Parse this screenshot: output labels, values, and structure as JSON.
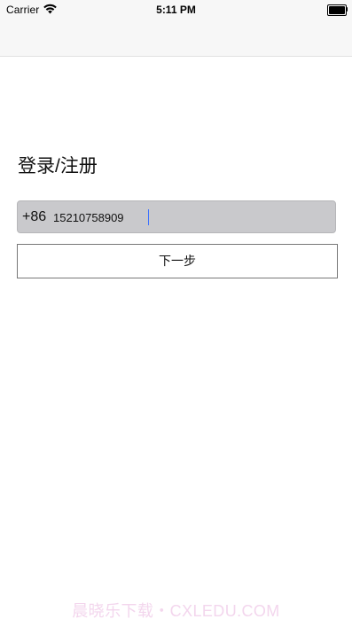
{
  "status_bar": {
    "carrier": "Carrier",
    "time": "5:11 PM",
    "battery_level": 1.0
  },
  "icons": {
    "wifi": "wifi-icon",
    "battery": "battery-icon"
  },
  "login": {
    "title": "登录/注册",
    "country_code": "+86",
    "phone_value": "15210758909",
    "next_label": "下一步"
  },
  "watermark": {
    "text": "晨晓乐下载・CXLEDU.COM"
  },
  "colors": {
    "input_bg": "#c9c9cc",
    "caret": "#3d72ff",
    "watermark": "#f2d2ec"
  }
}
